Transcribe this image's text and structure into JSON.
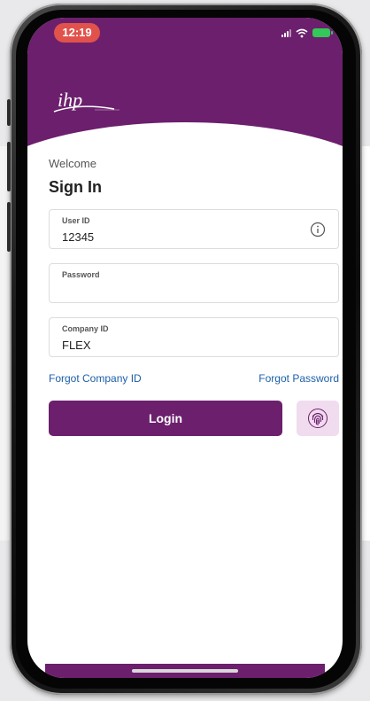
{
  "status_bar": {
    "time": "12:19"
  },
  "app": {
    "logo_text": "ihp"
  },
  "colors": {
    "brand_purple": "#6c1f6d",
    "link_blue": "#1d5fa8",
    "fingerprint_bg": "#f1dcef",
    "time_pill": "#e0524b",
    "battery": "#34c759"
  },
  "form": {
    "welcome": "Welcome",
    "title": "Sign In",
    "user_id": {
      "label": "User ID",
      "value": "12345"
    },
    "password": {
      "label": "Password",
      "value": ""
    },
    "company_id": {
      "label": "Company ID",
      "value": "FLEX"
    }
  },
  "links": {
    "forgot_company": "Forgot Company ID",
    "forgot_password": "Forgot Password"
  },
  "buttons": {
    "login": "Login"
  },
  "icons": [
    "signal-icon",
    "wifi-icon",
    "battery-icon",
    "info-icon",
    "fingerprint-icon"
  ]
}
